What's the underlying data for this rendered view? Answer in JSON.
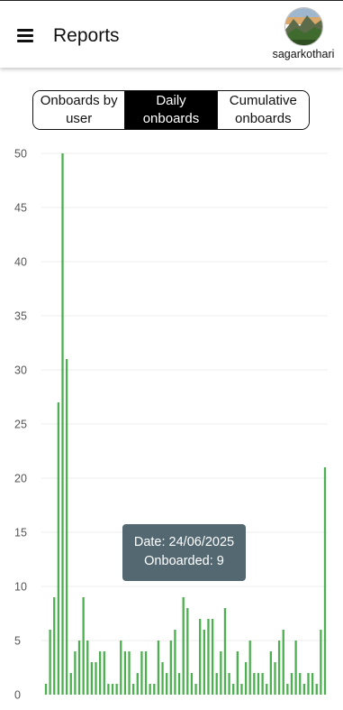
{
  "header": {
    "title": "Reports",
    "username": "sagarkothari",
    "menu_icon": "hamburger-menu-icon"
  },
  "tabs": [
    {
      "label": "Onboards by\nuser",
      "active": false
    },
    {
      "label": "Daily\nonboards",
      "active": true
    },
    {
      "label": "Cumulative\nonboards",
      "active": false
    }
  ],
  "chart_data": {
    "type": "bar",
    "ylim": [
      0,
      50
    ],
    "yticks": [
      0,
      5,
      10,
      15,
      20,
      25,
      30,
      35,
      40,
      45,
      50
    ],
    "grid": true,
    "bar_color": "#4caf50",
    "values": [
      1,
      6,
      9,
      27,
      50,
      31,
      2,
      4,
      5,
      9,
      5,
      3,
      3,
      4,
      4,
      1,
      1,
      1,
      5,
      4,
      4,
      1,
      2,
      4,
      4,
      1,
      1,
      5,
      3,
      2,
      5,
      6,
      2,
      9,
      8,
      2,
      1,
      7,
      6,
      7,
      7,
      2,
      4,
      8,
      2,
      1,
      4,
      1,
      3,
      5,
      2,
      2,
      2,
      1,
      4,
      3,
      5,
      6,
      1,
      2,
      5,
      2,
      1,
      2,
      2,
      1,
      6,
      21
    ]
  },
  "tooltip": {
    "date_line": "Date: 24/06/2025",
    "count_line": "Onboarded: 9"
  },
  "colors": {
    "accent": "#4caf50",
    "tooltip_bg": "#546872",
    "gridline": "#eeeeee",
    "axis_text": "#555555"
  }
}
